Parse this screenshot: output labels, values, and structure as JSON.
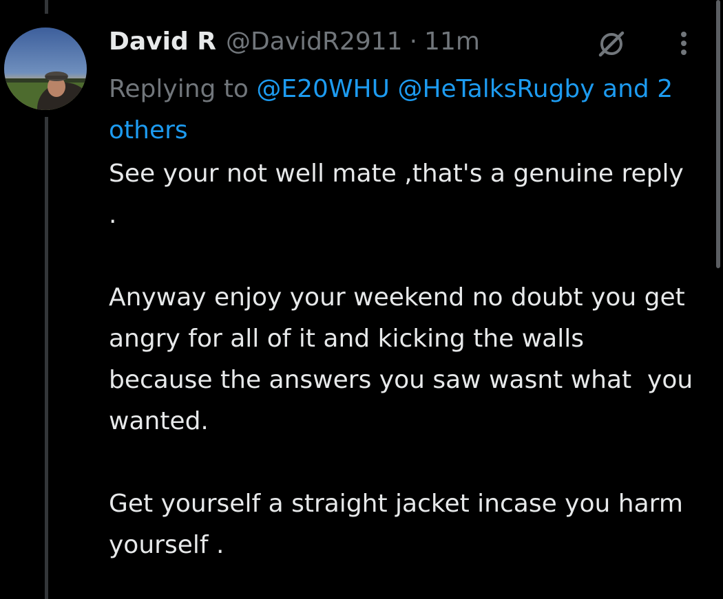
{
  "tweet": {
    "display_name": "David R",
    "handle": "@DavidR2911",
    "separator": "·",
    "time": "11m",
    "avatar": "avatar-photo",
    "reply_prefix": "Replying to ",
    "mentions": [
      "@E20WHU",
      "@HeTalksRugby"
    ],
    "reply_others": "and 2 others",
    "body": [
      "See your not well mate ,that's a genuine reply .",
      "Anyway enjoy your weekend no doubt you get angry for all of it and kicking the walls because the answers you saw wasnt what  you wanted.",
      "Get yourself a straight jacket incase you harm yourself ."
    ]
  },
  "icons": {
    "grok": "grok-icon",
    "more": "more-vertical-icon"
  },
  "colors": {
    "background": "#000000",
    "text_primary": "#e7e9ea",
    "text_secondary": "#71767b",
    "link": "#1d9bf0",
    "thread_line": "#333639"
  }
}
